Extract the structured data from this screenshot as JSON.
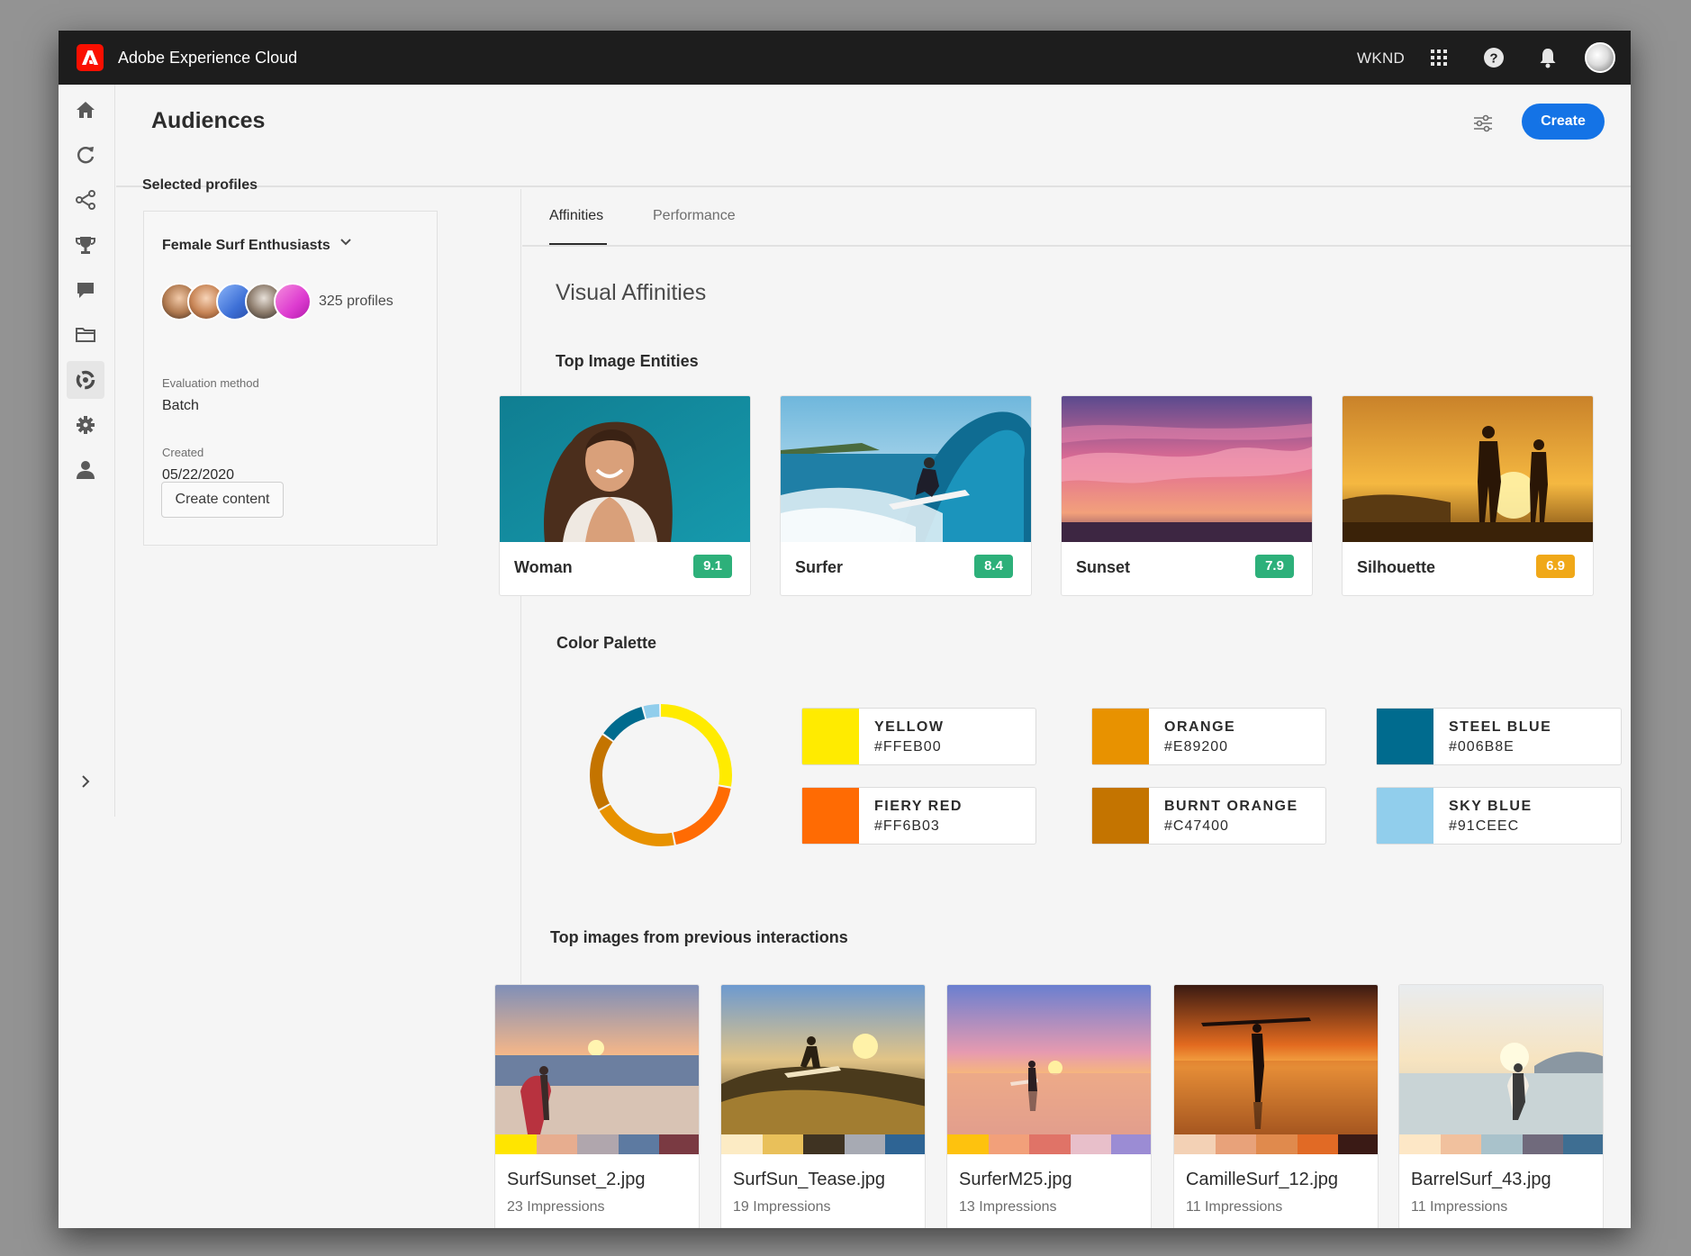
{
  "topbar": {
    "app_title": "Adobe Experience Cloud",
    "org": "WKND",
    "icons": [
      "adobe-logo",
      "apps-grid-icon",
      "help-icon",
      "bell-icon",
      "avatar"
    ]
  },
  "rail": {
    "icons": [
      "home-icon",
      "refresh-icon",
      "journey-icon",
      "trophy-icon",
      "chat-icon",
      "folder-icon",
      "audiences-icon",
      "gear-icon",
      "user-icon"
    ],
    "active": "audiences-icon",
    "expand_icon": "chevron-right-icon"
  },
  "header": {
    "title": "Audiences",
    "create_label": "Create",
    "filter_icon": "sliders-icon"
  },
  "profiles": {
    "heading": "Selected profiles",
    "segment_name": "Female Surf Enthusiasts",
    "count_label": "325 profiles",
    "evaluation_label": "Evaluation method",
    "evaluation_value": "Batch",
    "created_label": "Created",
    "created_value": "05/22/2020",
    "create_content_label": "Create content"
  },
  "tabs": {
    "affinities": "Affinities",
    "performance": "Performance",
    "selected": "Affinities"
  },
  "affinities": {
    "title": "Visual Affinities",
    "entities_heading": "Top Image Entities",
    "entities": [
      {
        "name": "Woman",
        "score": "9.1",
        "color": "#2db07a"
      },
      {
        "name": "Surfer",
        "score": "8.4",
        "color": "#2db07a"
      },
      {
        "name": "Sunset",
        "score": "7.9",
        "color": "#2db07a"
      },
      {
        "name": "Silhouette",
        "score": "6.9",
        "color": "#f0a818"
      }
    ],
    "palette_heading": "Color Palette",
    "palette": [
      {
        "name": "YELLOW",
        "hex": "#FFEB00"
      },
      {
        "name": "ORANGE",
        "hex": "#E89200"
      },
      {
        "name": "STEEL BLUE",
        "hex": "#006B8E"
      },
      {
        "name": "FIERY RED",
        "hex": "#FF6B03"
      },
      {
        "name": "BURNT ORANGE",
        "hex": "#C47400"
      },
      {
        "name": "SKY BLUE",
        "hex": "#91CEEC"
      }
    ],
    "donut_shares": [
      {
        "name": "YELLOW",
        "value": 28,
        "color": "#ffeb00"
      },
      {
        "name": "FIERY RED",
        "value": 19,
        "color": "#ff6b03"
      },
      {
        "name": "ORANGE",
        "value": 20,
        "color": "#e89200"
      },
      {
        "name": "BURNT ORANGE",
        "value": 18,
        "color": "#c47400"
      },
      {
        "name": "STEEL BLUE",
        "value": 11,
        "color": "#006b8e"
      },
      {
        "name": "SKY BLUE",
        "value": 4,
        "color": "#91ceec"
      }
    ],
    "top_images_heading": "Top images from previous interactions",
    "top_images": [
      {
        "file": "SurfSunset_2.jpg",
        "impressions": "23 Impressions",
        "strip": [
          "#ffe500",
          "#e7ad8f",
          "#b0a6ad",
          "#5d7aa1",
          "#7a3a42"
        ]
      },
      {
        "file": "SurfSun_Tease.jpg",
        "impressions": "19 Impressions",
        "strip": [
          "#fcebc4",
          "#e9c05a",
          "#3f3322",
          "#a7aab3",
          "#2e6494"
        ]
      },
      {
        "file": "SurferM25.jpg",
        "impressions": "13 Impressions",
        "strip": [
          "#fec20e",
          "#f2a07a",
          "#e07367",
          "#e8bfca",
          "#9b8cd4"
        ]
      },
      {
        "file": "CamilleSurf_12.jpg",
        "impressions": "11 Impressions",
        "strip": [
          "#f3d1b5",
          "#e8a27a",
          "#e08a4d",
          "#e16a25",
          "#3a1a15"
        ]
      },
      {
        "file": "BarrelSurf_43.jpg",
        "impressions": "11 Impressions",
        "strip": [
          "#fde7c6",
          "#f1c19e",
          "#a9c2cb",
          "#706a7c",
          "#3e6e92"
        ]
      }
    ]
  }
}
